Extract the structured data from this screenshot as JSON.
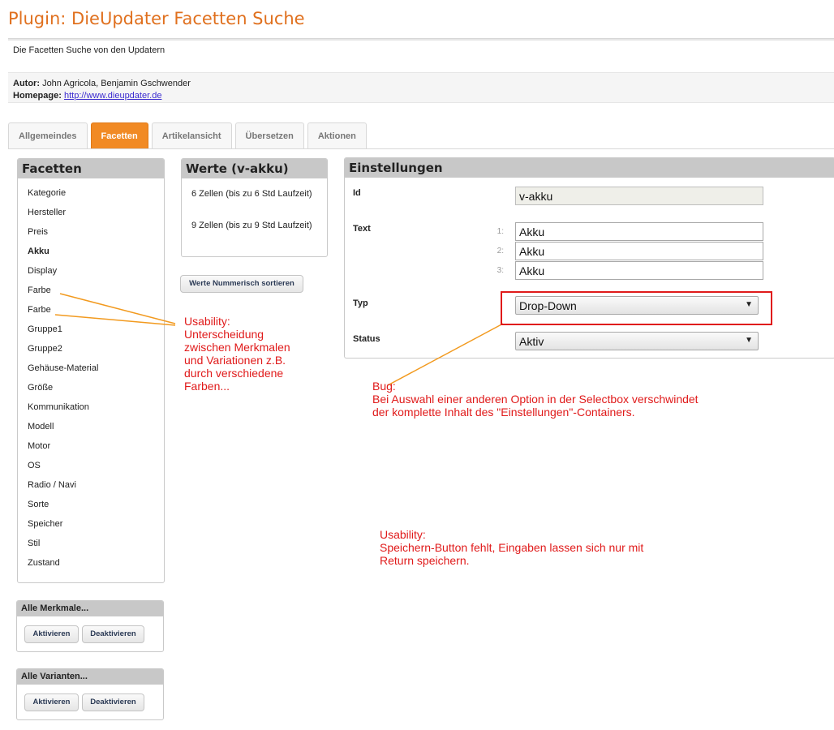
{
  "header": {
    "title": "Plugin: DieUpdater Facetten Suche",
    "description": "Die Facetten Suche von den Updatern",
    "author_label": "Autor:",
    "author": "John Agricola, Benjamin Gschwender",
    "homepage_label": "Homepage:",
    "homepage_url": "http://www.dieupdater.de"
  },
  "tabs": [
    {
      "label": "Allgemeindes",
      "active": false
    },
    {
      "label": "Facetten",
      "active": true
    },
    {
      "label": "Artikelansicht",
      "active": false
    },
    {
      "label": "Übersetzen",
      "active": false
    },
    {
      "label": "Aktionen",
      "active": false
    }
  ],
  "facetten": {
    "title": "Facetten",
    "selected": "Akku",
    "items": [
      "Kategorie",
      "Hersteller",
      "Preis",
      "Akku",
      "Display",
      "Farbe",
      "Farbe",
      "Gruppe1",
      "Gruppe2",
      "Gehäuse-Material",
      "Größe",
      "Kommunikation",
      "Modell",
      "Motor",
      "OS",
      "Radio / Navi",
      "Sorte",
      "Speicher",
      "Stil",
      "Zustand"
    ]
  },
  "werte": {
    "title": "Werte (v-akku)",
    "items": [
      "6 Zellen (bis zu 6 Std Laufzeit)",
      "9 Zellen (bis zu 9 Std Laufzeit)"
    ],
    "sort_button": "Werte Nummerisch sortieren"
  },
  "einstellungen": {
    "title": "Einstellungen",
    "id_label": "Id",
    "id_value": "v-akku",
    "text_label": "Text",
    "text_rows": [
      {
        "index": "1:",
        "value": "Akku"
      },
      {
        "index": "2:",
        "value": "Akku"
      },
      {
        "index": "3:",
        "value": "Akku"
      }
    ],
    "typ_label": "Typ",
    "typ_value": "Drop-Down",
    "status_label": "Status",
    "status_value": "Aktiv"
  },
  "merkmale": {
    "title": "Alle Merkmale...",
    "activate": "Aktivieren",
    "deactivate": "Deaktivieren"
  },
  "varianten": {
    "title": "Alle Varianten...",
    "activate": "Aktivieren",
    "deactivate": "Deaktivieren"
  },
  "annotations": {
    "usability_1": "Usability:\nUnterscheidung\nzwischen Merkmalen\nund Variationen z.B.\ndurch verschiedene\nFarben...",
    "bug": "Bug:\nBei Auswahl einer anderen Option in der Selectbox verschwindet\nder komplette Inhalt des \"Einstellungen\"-Containers.",
    "usability_2": "Usability:\nSpeichern-Button fehlt, Eingaben lassen sich nur mit\nReturn speichern.",
    "color": "#e01a1a",
    "line_color": "#f29a1f"
  },
  "colors": {
    "accent": "#e0701e",
    "active_tab": "#f18a24"
  }
}
